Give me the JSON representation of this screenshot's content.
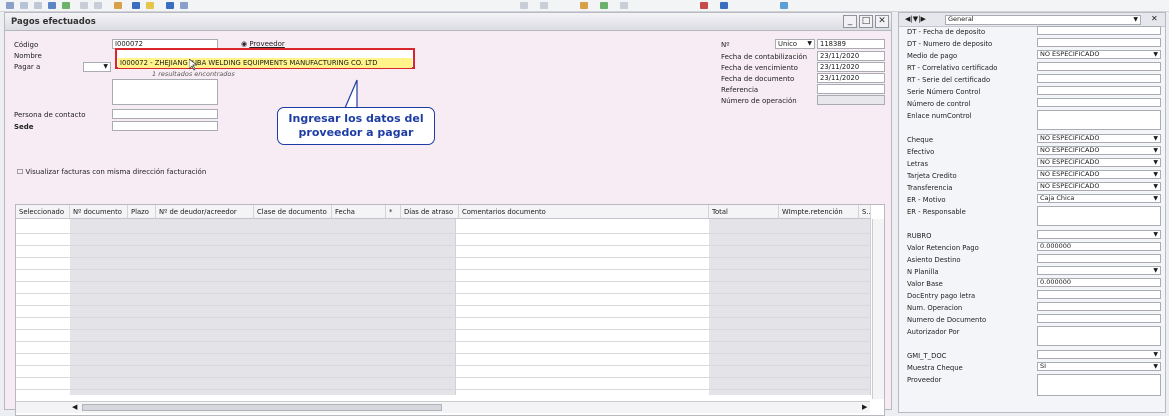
{
  "window": {
    "title": "Pagos efectuados"
  },
  "header": {
    "codigo_label": "Código",
    "codigo_value": "I000072",
    "proveedor_label": "Proveedor",
    "nombre_label": "Nombre",
    "pagar_a_label": "Pagar a",
    "persona_contacto_label": "Persona de contacto",
    "sede_label": "Sede",
    "visualizar_label": "Visualizar facturas con misma dirección facturación"
  },
  "popup": {
    "result": "I000072  -  ZHEJIANG JUBA WELDING EQUIPMENTS MANUFACTURING CO. LTD",
    "count_text": "1 resultados encontrados"
  },
  "callout": {
    "line1": "Ingresar los datos del",
    "line2": "proveedor a pagar"
  },
  "doc": {
    "no_label": "Nº",
    "series": "Unico",
    "number": "118389",
    "fecha_contab_label": "Fecha de contabilización",
    "fecha_contab": "23/11/2020",
    "fecha_venc_label": "Fecha de vencimiento",
    "fecha_venc": "23/11/2020",
    "fecha_doc_label": "Fecha de documento",
    "fecha_doc": "23/11/2020",
    "referencia_label": "Referencia",
    "num_operacion_label": "Número de operación"
  },
  "grid": {
    "columns": [
      "Seleccionado",
      "Nº documento",
      "Plazo",
      "Nº de deudor/acreedor",
      "Clase de documento",
      "Fecha",
      "*",
      "Días de atraso",
      "Comentarios documento",
      "Total",
      "WImpte.retención",
      "S.."
    ]
  },
  "panel": {
    "selector": "General",
    "rows": [
      {
        "label": "DT - Fecha de deposito",
        "value": ""
      },
      {
        "label": "DT - Numero de deposito",
        "value": ""
      },
      {
        "label": "Medio de pago",
        "value": "NO ESPECIFICADO"
      },
      {
        "label": "RT - Correlativo certificado",
        "value": ""
      },
      {
        "label": "RT - Serie del certificado",
        "value": ""
      },
      {
        "label": "Serie Número Control",
        "value": ""
      },
      {
        "label": "Número de control",
        "value": ""
      },
      {
        "label": "Enlace numControl",
        "value": ""
      },
      {
        "label": "Cheque",
        "value": "NO ESPECIFICADO"
      },
      {
        "label": "Efectivo",
        "value": "NO ESPECIFICADO"
      },
      {
        "label": "Letras",
        "value": "NO ESPECIFICADO"
      },
      {
        "label": "Tarjeta Credito",
        "value": "NO ESPECIFICADO"
      },
      {
        "label": "Transferencia",
        "value": "NO ESPECIFICADO"
      },
      {
        "label": "ER - Motivo",
        "value": "Caja Chica"
      },
      {
        "label": "ER - Responsable",
        "value": ""
      },
      {
        "label": "RUBRO",
        "value": ""
      },
      {
        "label": "Valor Retencion Pago",
        "value": "0.000000"
      },
      {
        "label": "Asiento Destino",
        "value": ""
      },
      {
        "label": "N Planilla",
        "value": ""
      },
      {
        "label": "Valor Base",
        "value": "0.000000"
      },
      {
        "label": "DocEntry pago letra",
        "value": ""
      },
      {
        "label": "Num. Operacion",
        "value": ""
      },
      {
        "label": "Numero de Documento",
        "value": ""
      },
      {
        "label": "Autorizador Por",
        "value": ""
      },
      {
        "label": "GMI_T_DOC",
        "value": ""
      },
      {
        "label": "Muestra Cheque",
        "value": "SI"
      },
      {
        "label": "Proveedor",
        "value": ""
      }
    ]
  }
}
